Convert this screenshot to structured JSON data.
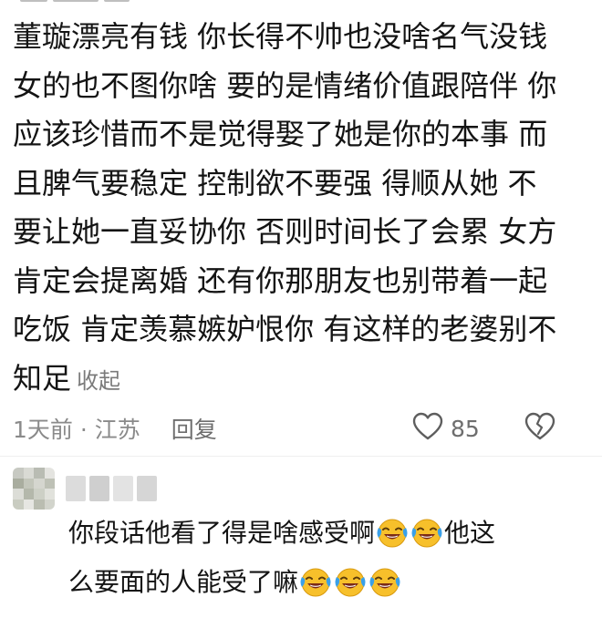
{
  "comment": {
    "lines": [
      "董璇漂亮有钱 你长得不帅也没啥名气没钱",
      "女的也不图你啥 要的是情绪价值跟陪伴 你",
      "应该珍惜而不是觉得娶了她是你的本事 而",
      "且脾气要稳定  控制欲不要强 得顺从她 不",
      "要让她一直妥协你  否则时间长了会累 女方",
      "肯定会提离婚 还有你那朋友也别带着一起",
      "吃饭 肯定羡慕嫉妒恨你 有这样的老婆别不",
      "知足"
    ],
    "collapse_label": "收起",
    "time_location": "1天前 · 江苏",
    "reply_label": "回复",
    "like_count": "85",
    "like_icon": "heart-outline-icon",
    "dislike_icon": "broken-heart-icon"
  },
  "reply": {
    "line1_text": "你段话他看了得是啥感受啊",
    "line1_tail": "他这",
    "line2_text": "么要面的人能受了嘛",
    "emoji_icon": "laughing-crying-emoji",
    "line1_emoji_count": 2,
    "line2_emoji_count": 3
  },
  "colors": {
    "text": "#141414",
    "meta": "#8a8a8a",
    "collapse": "#7b7b7b",
    "emoji_face": "#f7c02b"
  }
}
